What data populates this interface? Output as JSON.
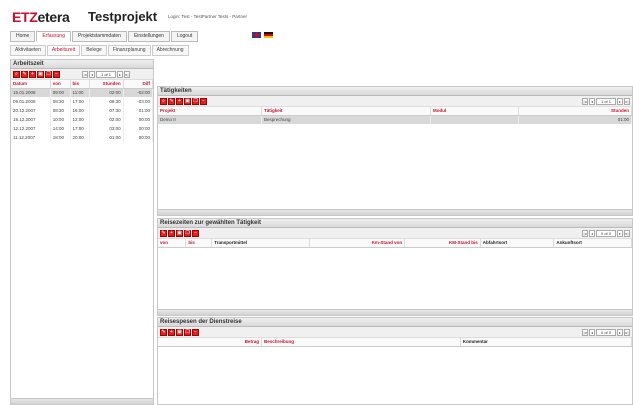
{
  "header": {
    "logo_red": "ETZ",
    "logo_rest": "etera",
    "project": "Testprojekt",
    "login_info": "Login: Test - TestPartner Tests - Partner"
  },
  "main_nav": [
    "Home",
    "Erfassung",
    "Projektstammdaten",
    "Einstellungen",
    "Logout"
  ],
  "main_nav_active": "Erfassung",
  "sub_nav": [
    "Aktivitaeten",
    "Arbeitszeit",
    "Belege",
    "Finanzplanung",
    "Abrechnung"
  ],
  "sub_nav_active": "Arbeitszeit",
  "arbeitszeit": {
    "title": "Arbeitszeit",
    "pager_value": "1 of 1",
    "columns": [
      "Datum",
      "von",
      "bis",
      "Stunden",
      "Diff"
    ],
    "rows": [
      [
        "15.01.2008",
        "09:00",
        "11:00",
        "02:00",
        "-02:00"
      ],
      [
        "09.01.2008",
        "08:30",
        "17:00",
        "08:30",
        "-03:00"
      ],
      [
        "20.12.2007",
        "08:30",
        "16:00",
        "07:30",
        "01:00"
      ],
      [
        "19.12.2007",
        "10:00",
        "12:00",
        "02:00",
        "00:00"
      ],
      [
        "12.12.2007",
        "14:00",
        "17:00",
        "03:00",
        "00:00"
      ],
      [
        "11.12.2007",
        "18:00",
        "20:00",
        "01:00",
        "00:00"
      ]
    ]
  },
  "taetigkeiten": {
    "title": "Tätigkeiten",
    "pager_value": "1 of 1",
    "columns": [
      "Projekt",
      "Tätigkeit",
      "Modul",
      "Stunden"
    ],
    "rows": [
      [
        "Demo II",
        "Besprechung",
        "",
        "01:00"
      ]
    ]
  },
  "reisezeiten": {
    "title": "Reisezeiten zur gewählten Tätigkeit",
    "pager_value": "0 of 0",
    "columns": [
      "von",
      "bis",
      "Transportmittel",
      "Km-Stand von",
      "KM-Stand bis",
      "Abfahrtsort",
      "Ankunftsort"
    ]
  },
  "reisespesen": {
    "title": "Reisespesen der Dienstreise",
    "pager_value": "0 of 0",
    "columns": [
      "Betrag",
      "Beschreibung",
      "Kommentar"
    ]
  },
  "colors": {
    "accent": "#c8102e",
    "selected_row": "#d8d8d8"
  }
}
